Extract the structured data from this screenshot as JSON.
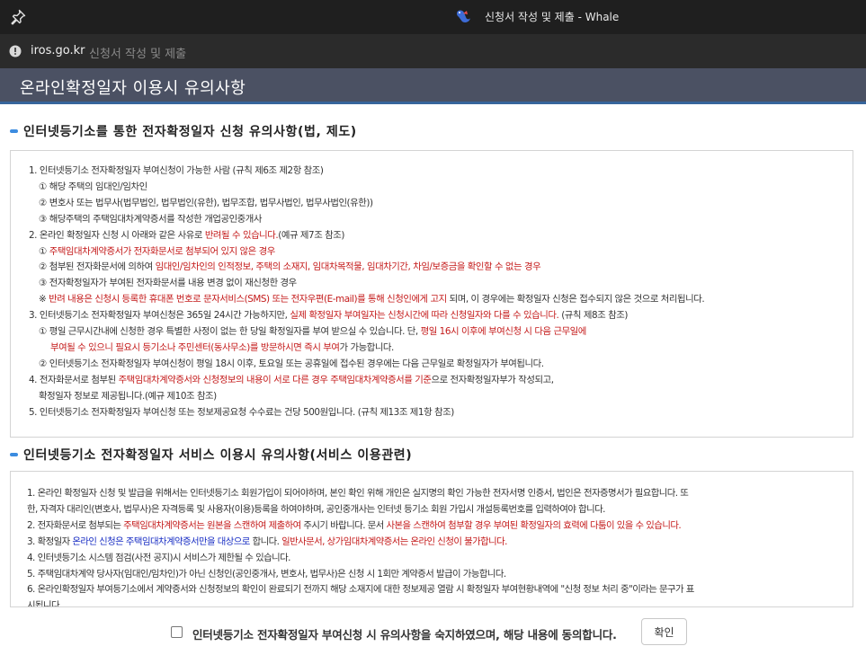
{
  "window": {
    "title": "신청서 작성 및 제출 - Whale",
    "url_host": "iros.go.kr",
    "url_page_title": "신청서 작성 및 제출"
  },
  "page": {
    "title": "온라인확정일자 이용시 유의사항"
  },
  "section1": {
    "heading": "인터넷등기소를 통한 전자확정일자 신청 유의사항(법, 제도)",
    "l1": "1. 인터넷등기소 전자확정일자 부여신청이 가능한 사람 (규칙 제6조 제2항 참조)",
    "l2": "① 해당 주택의 임대인/임차인",
    "l3": "② 변호사 또는 법무사(법무법인, 법무법인(유한), 법무조합, 법무사법인, 법무사법인(유한))",
    "l4": "③ 해당주택의 주택임대차계약증서를 작성한 개업공인중개사",
    "l5a": "2. 온라인 확정일자 신청 시 아래와 같은 사유로 ",
    "l5b": "반려될 수 있습니다.",
    "l5c": "(예규 제7조 참조)",
    "l6a": "① ",
    "l6b": "주택임대차계약증서가 전자화문서로 첨부되어 있지 않은 경우",
    "l7a": "② 첨부된 전자화문서에 의하여 ",
    "l7b": "임대인/임차인의 인적정보, 주택의 소재지, 임대차목적물, 임대차기간, 차임/보증금을 확인할 수 없는 경우",
    "l8": "③ 전자확정일자가 부여된 전자화문서를 내용 변경 없이 재신청한 경우",
    "l9a": "※ ",
    "l9b": "반려 내용은 신청시 등록한 휴대폰 번호로 문자서비스(SMS) 또는 전자우편(E-mail)를 통해 신청인에게 고지",
    "l9c": " 되며, 이 경우에는 확정일자 신청은 접수되지 않은 것으로 처리됩니다.",
    "l10a": "3. 인터넷등기소 전자확정일자 부여신청은 365일 24시간 가능하지만, ",
    "l10b": "실제 확정일자 부여일자는 신청시간에 따라 신청일자와 다를 수 있습니다.",
    "l10c": " (규칙 제8조 참조)",
    "l11a": "① 평일 근무시간내에 신청한 경우 특별한 사정이 없는 한 당일 확정일자를 부여 받으실 수 있습니다. 단, ",
    "l11b": "평일 16시 이후에 부여신청 시 다음 근무일에",
    "l12a": "부여될 수 있으니 필요시 등기소나 주민센터(동사무소)를 방문하시면 즉시 부여",
    "l12b": "가 가능합니다.",
    "l13": "② 인터넷등기소 전자확정일자 부여신청이 평일 18시 이후, 토요일 또는 공휴일에 접수된 경우에는 다음 근무일로 확정일자가 부여됩니다.",
    "l14a": "4. 전자화문서로 첨부된 ",
    "l14b": "주택임대차계약증서와 신청정보의 내용이 서로 다른 경우 주택임대차계약증서를 기준",
    "l14c": "으로 전자확정일자부가 작성되고,",
    "l15": "확정일자 정보로 제공됩니다.(예규 제10조 참조)",
    "l16": "5. 인터넷등기소 전자확정일자 부여신청 또는 정보제공요청 수수료는 건당 500원입니다. (규칙 제13조 제1항 참조)"
  },
  "section2": {
    "heading": "인터넷등기소 전자확정일자 서비스 이용시 유의사항(서비스 이용관련)",
    "l1": "1. 온라인 확정일자 신청 및 발급을 위해서는 인터넷등기소 회원가입이 되어야하며, 본인 확인 위해 개인은 실지명의 확인 가능한 전자서명 인증서, 법인은 전자증명서가 필요합니다. 또",
    "l2": "한, 자격자 대리인(변호사, 법무사)은 자격등록 및 사용자(이용)등록을 하여야하며, 공인중개사는 인터넷 등기소 회원 가입시 개설등록번호를 입력하여야 합니다.",
    "l3a": "2. 전자화문서로 첨부되는 ",
    "l3b": "주택임대차계약증서는 원본을 스캔하여 제출하여",
    "l3c": " 주시기 바랍니다. 문서 ",
    "l3d": "사본을 스캔하여 첨부할 경우 부여된 확정일자의 효력에 다툼이 있을 수 있습니다.",
    "l4a": "3. 확정일자 ",
    "l4b": "온라인 신청은 주택임대차계약증서만을 대상으로",
    "l4c": " 합니다. ",
    "l4d": "일반사문서, 상가임대차계약증서는 온라인 신청이 불가합니다.",
    "l5": "4. 인터넷등기소 시스템 점검(사전 공지)시 서비스가 제한될 수 있습니다.",
    "l6": "5. 주택임대차계약 당사자(임대인/임차인)가 아닌 신청인(공인중개사, 변호사, 법무사)은 신청 시 1회만 계약증서 발급이 가능합니다.",
    "l7": "6. 온라인확정일자 부여등기소에서 계약증서와 신청정보의 확인이 완료되기 전까지 해당 소재지에 대한 정보제공 열람 시 확정일자 부여현황내역에 \"신청 정보 처리 중\"이라는 문구가 표",
    "l8": "시됩니다."
  },
  "agreement": {
    "label": "인터넷등기소 전자확정일자 부여신청 시 유의사항을 숙지하였으며, 해당 내용에 동의합니다.",
    "confirm_label": "확인"
  },
  "colors": {
    "warning": "#c41a1a",
    "emphasis": "#1a2fc4",
    "header_bg": "#4b5163",
    "section_bar": "#3c8ce0"
  },
  "icons": {
    "pin": "pin-icon",
    "app": "whale-app-icon",
    "info": "info-icon",
    "section": "section-bar-icon",
    "checkbox": "checkbox"
  }
}
